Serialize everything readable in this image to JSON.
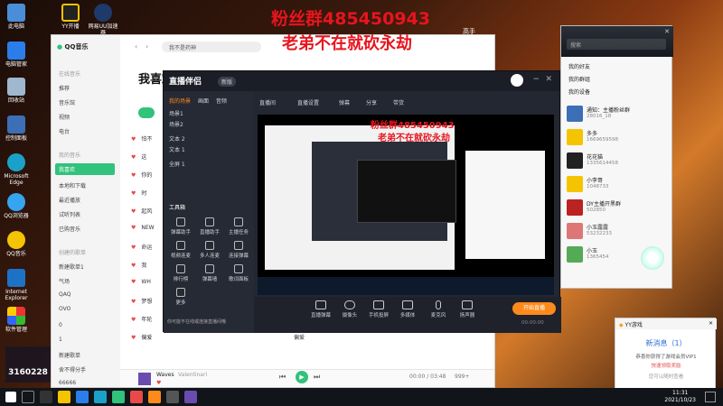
{
  "overlay": {
    "fan_group_top": "粉丝群485450943",
    "slogan_top": "老弟不在就砍永劫",
    "fan_group_mid": "粉丝群485450943",
    "slogan_mid": "老弟不在就砍永劫",
    "badge_left": "3160228",
    "gaoshou": "高手"
  },
  "desktop_icons": [
    "此电脑",
    "电脑管家",
    "回收站",
    "控制面板",
    "Microsoft Edge",
    "QQ浏览器",
    "QQ音乐",
    "Internet Explorer",
    "软件管理",
    "YY开播",
    "网易UU加速器"
  ],
  "qq_music": {
    "app_name": "QQ音乐",
    "search_value": "我不是药神",
    "page_title": "我喜欢",
    "sidebar": {
      "online_header": "在线音乐",
      "online": [
        "推荐",
        "音乐馆",
        "视频",
        "电台"
      ],
      "mine_header": "我的音乐",
      "mine": [
        "我喜欢",
        "本地和下载",
        "最近播放",
        "试听列表",
        "已购音乐"
      ],
      "created_header": "创建的歌单",
      "created": [
        "新建歌单1",
        "气场",
        "QAQ",
        "OVO",
        "0",
        "1",
        "新建歌单",
        "舍不得分手"
      ],
      "footer_text": "66666"
    },
    "songs": [
      {
        "title": "怕不",
        "artist": "",
        "album": ""
      },
      {
        "title": "这",
        "artist": "",
        "album": ""
      },
      {
        "title": "你的",
        "artist": "",
        "album": ""
      },
      {
        "title": "时",
        "artist": "",
        "album": ""
      },
      {
        "title": "起风",
        "artist": "",
        "album": ""
      },
      {
        "title": "NEW",
        "artist": "",
        "album": ""
      },
      {
        "title": "命运",
        "artist": "",
        "album": ""
      },
      {
        "title": "我",
        "artist": "",
        "album": ""
      },
      {
        "title": "WH",
        "artist": "",
        "album": ""
      },
      {
        "title": "梦想",
        "artist": "",
        "album": ""
      },
      {
        "title": "年轮",
        "artist": "",
        "album": "不是花火呀"
      },
      {
        "title": "偏爱",
        "artist": "",
        "album": "偏爱"
      }
    ],
    "player": {
      "now_playing": "Waves",
      "artist": "Valentinari",
      "time": "00:00 / 03:48",
      "quality": "标准",
      "volume_label": "999+"
    }
  },
  "zhibo": {
    "app_name": "直播伴侣",
    "version_badge": "新版",
    "left_tabs": [
      "我的场景",
      "画面",
      "音频"
    ],
    "scenes": [
      "场景1",
      "场景2",
      "文本 2",
      "文本 1",
      "全屏 1"
    ],
    "tools_header": "工具箱",
    "tools": [
      "弹幕助手",
      "直播助手",
      "主播任务",
      "视频连麦",
      "多人连麦",
      "连接弹幕",
      "排行榜",
      "弹幕墙",
      "歌词面板",
      "更多"
    ],
    "notice": "你可能不在线或连接直播间哦",
    "top_bar": [
      "直播间",
      "直播设置",
      "弹幕",
      "分享",
      "带货"
    ],
    "bottom_tools": [
      "直播弹幕",
      "摄像头",
      "手机投屏",
      "多媒体",
      "麦克风",
      "扬声器"
    ],
    "start_button": "开始直播",
    "timer": "00:00:00"
  },
  "qq_contacts": {
    "search_placeholder": "搜索",
    "groups": [
      "我的好友",
      "我的群组",
      "我的设备"
    ],
    "contacts": [
      {
        "name": "通知：主播粉丝群",
        "sign": "28016_18"
      },
      {
        "name": "多多",
        "sign": "1669659598"
      },
      {
        "name": "花花猫",
        "sign": "1335614458"
      },
      {
        "name": "小李哥",
        "sign": "1048733"
      },
      {
        "name": "DY主播开黑群",
        "sign": "502850"
      },
      {
        "name": "小玉露露",
        "sign": "53232233"
      },
      {
        "name": "小玉",
        "sign": "1365454"
      }
    ]
  },
  "popup": {
    "title": "YY游戏",
    "headline": "新消息（1）",
    "body": "恭喜你获得了游戏会员VIP1",
    "link": "快速领取奖励",
    "extra": "您可以随时查看"
  },
  "taskbar": {
    "time": "11:31",
    "date": "2021/10/23"
  },
  "colors": {
    "accent_green": "#31c27c",
    "start_orange": "#ff8a1c",
    "overlay_red": "#e8141e",
    "zb_bg": "#232731"
  }
}
